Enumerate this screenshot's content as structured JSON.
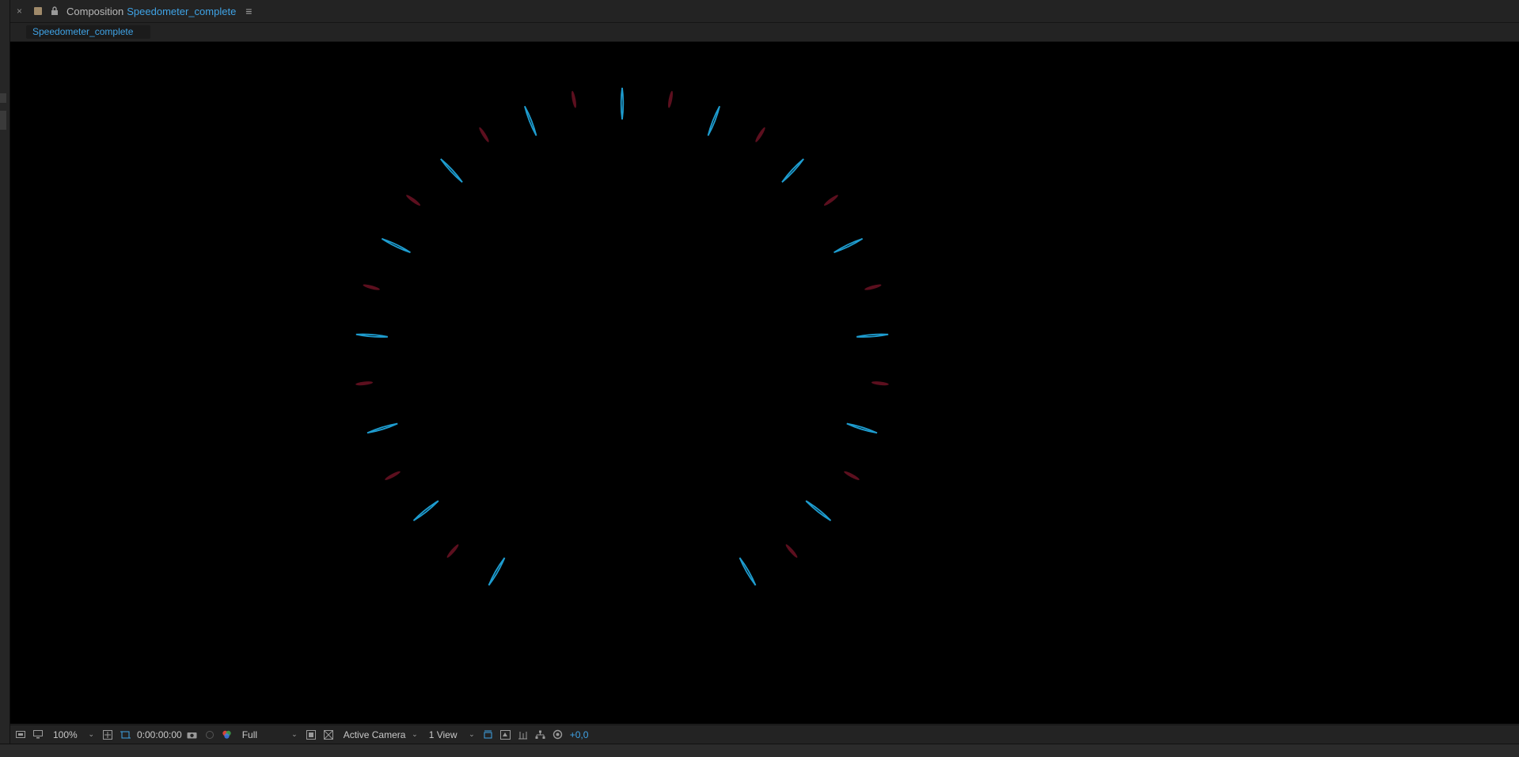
{
  "panel": {
    "close_glyph": "×",
    "title": "Composition",
    "composition_name": "Speedometer_complete",
    "menu_glyph": "≡"
  },
  "tab": {
    "label": "Speedometer_complete"
  },
  "viewer": {
    "background": "#000000",
    "colors": {
      "major_tick": "#1e9dd0",
      "minor_tick": "#5c0f1e"
    }
  },
  "footer": {
    "zoom": "100%",
    "timecode": "0:00:00:00",
    "resolution": "Full",
    "camera": "Active Camera",
    "views": "1 View",
    "exposure": "+0,0",
    "chevron": "⌄"
  }
}
